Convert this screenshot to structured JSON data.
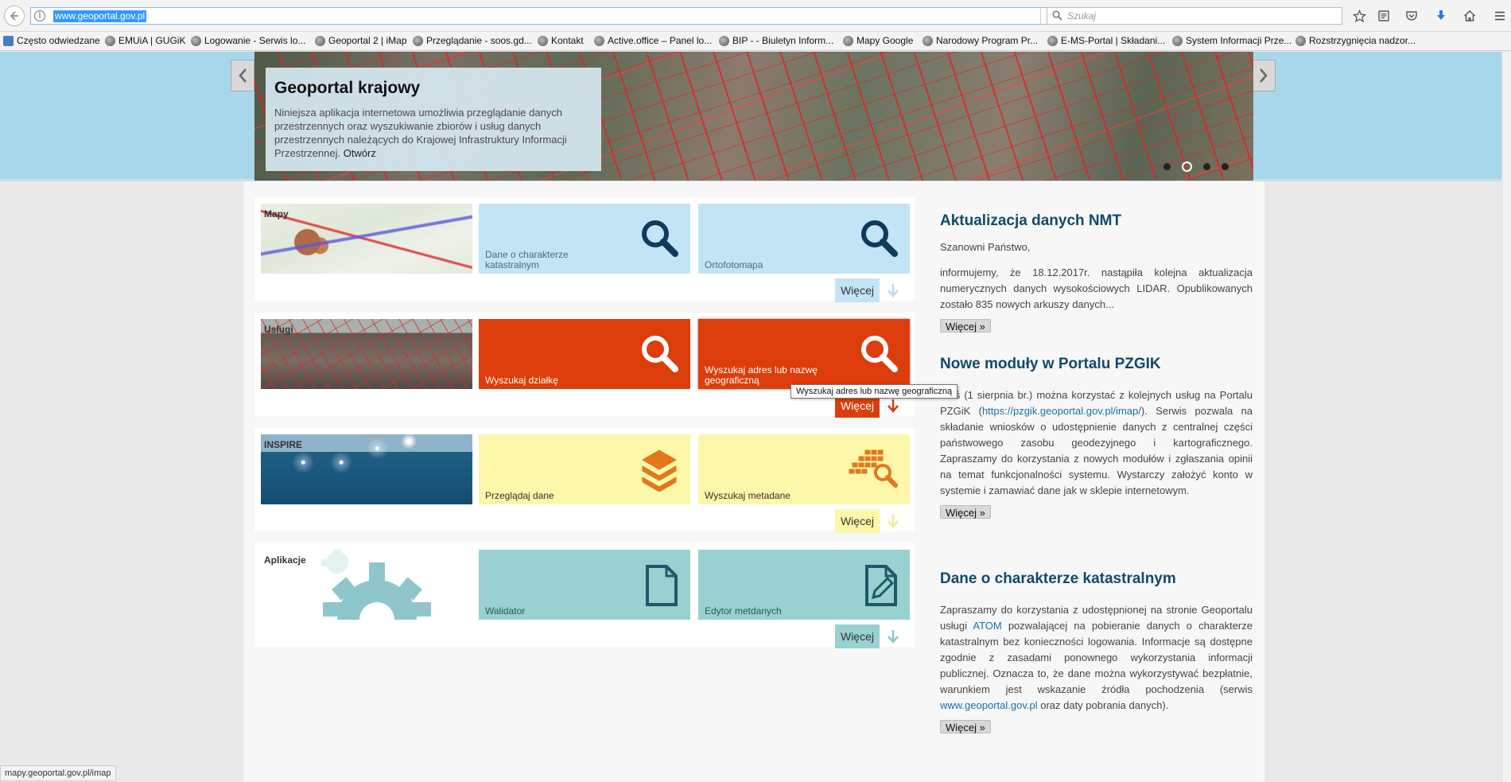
{
  "browser": {
    "url": "www.geoportal.gov.pl",
    "search_placeholder": "Szukaj",
    "status_url": "mapy.geoportal.gov.pl/imap"
  },
  "bookmarks": [
    "Często odwiedzane",
    "EMUiA | GUGiK",
    "Logowanie - Serwis lo...",
    "Geoportal 2 | iMap",
    "Przeglądanie - soos.gd...",
    "Kontakt",
    "Active.office – Panel lo...",
    "BIP - - Biuletyn Inform...",
    "Mapy Google",
    "Narodowy Program Pr...",
    "E-MS-Portal | Składani...",
    "System Informacji Prze...",
    "Rozstrzygnięcia nadzor..."
  ],
  "hero": {
    "title": "Geoportal krajowy",
    "text": "Niniejsza aplikacja internetowa umożliwia przeglądanie danych przestrzennych oraz wyszukiwanie zbiorów i usług danych przestrzennych należących do Krajowej Infrastruktury Informacji Przestrzennej.",
    "link": "Otwórz",
    "slides": 4,
    "active_slide": 2
  },
  "rows": [
    {
      "thumb_label": "Mapy",
      "tiles": [
        "Dane o charakterze katastralnym",
        "Ortofotomapa"
      ],
      "more": "Więcej",
      "tile_color": "#c3e4f4",
      "text_color": "#4a6d80",
      "icon_color": "#0e3a5c",
      "btn_color": "#c3e4f4",
      "btn_text": "#333",
      "arrow_color": "#b9dcef"
    },
    {
      "thumb_label": "Usługi",
      "tiles": [
        "Wyszukaj działkę",
        "Wyszukaj adres lub nazwę geograficzną"
      ],
      "more": "Więcej",
      "tile_color": "#dc3d0a",
      "text_color": "#ffffff",
      "icon_color": "#ffffff",
      "btn_color": "#dc3d0a",
      "btn_text": "#ffffff",
      "arrow_color": "#dc3d0a"
    },
    {
      "thumb_label": "INSPIRE",
      "tiles": [
        "Przeglądaj dane",
        "Wyszukaj metadane"
      ],
      "more": "Więcej",
      "tile_color": "#fdf7a9",
      "text_color": "#333333",
      "icon_color": "#e0791c",
      "btn_color": "#fdf7a9",
      "btn_text": "#333",
      "arrow_color": "#f3e98d"
    },
    {
      "thumb_label": "Aplikacje",
      "tiles": [
        "Walidator",
        "Edytor metdanych"
      ],
      "more": "Więcej",
      "tile_color": "#99d1d0",
      "text_color": "#2e5555",
      "icon_color": "#1f5a6a",
      "btn_color": "#99d1d0",
      "btn_text": "#333",
      "arrow_color": "#8ccaca"
    }
  ],
  "tooltip": "Wyszukaj adres lub nazwę geograficzną",
  "news": [
    {
      "title": "Aktualizacja danych NMT",
      "greeting": "Szanowni Państwo,",
      "body": "informujemy, że 18.12.2017r. nastąpiła kolejna aktualizacja numerycznych danych wysokościowych LIDAR. Opublikowanych zostało 835 nowych arkuszy danych...",
      "more": "Więcej »"
    },
    {
      "title": "Nowe moduły w Portalu PZGIK",
      "body_a": "Dziś (1 sierpnia br.) można korzystać z kolejnych usług na Portalu PZGiK (",
      "link": "https://pzgik.geoportal.gov.pl/imap/",
      "body_b": "). Serwis pozwala na składanie wniosków o udostępnienie danych z centralnej części państwowego zasobu geodezyjnego i kartograficznego. Zapraszamy do korzystania z nowych modułów i zgłaszania opinii na temat funkcjonalności systemu. Wystarczy założyć konto w systemie i zamawiać dane jak w sklepie internetowym.",
      "more": "Więcej »"
    },
    {
      "title": "Dane o charakterze katastralnym",
      "body_a": "Zapraszamy do korzystania z udostępnionej na stronie Geoportalu usługi ",
      "link1": "ATOM",
      "body_b": " pozwalającej na pobieranie danych o charakterze katastralnym bez konieczności logowania. Informacje są dostępne zgodnie z zasadami ponownego wykorzystania informacji publicznej. Oznacza to, że dane można wykorzystywać bezpłatnie, warunkiem jest wskazanie źródła pochodzenia (serwis ",
      "link2": "www.geoportal.gov.pl",
      "body_c": " oraz daty pobrania danych).",
      "more": "Więcej »"
    }
  ]
}
